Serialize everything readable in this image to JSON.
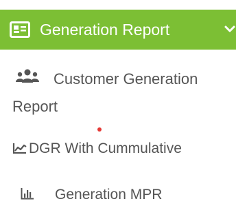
{
  "colors": {
    "accent": "#7cbf34",
    "text": "#555555",
    "dot": "#e53935"
  },
  "menu": {
    "header": {
      "icon": "id-card-icon",
      "label": "Generation Report",
      "chevron": "chevron-down-icon"
    },
    "items": [
      {
        "icon": "users-icon",
        "label": "Customer Generation Report"
      },
      {
        "icon": "area-chart-icon",
        "label": "DGR With Cummulative"
      },
      {
        "icon": "bar-chart-icon",
        "label": "Generation MPR"
      }
    ]
  }
}
